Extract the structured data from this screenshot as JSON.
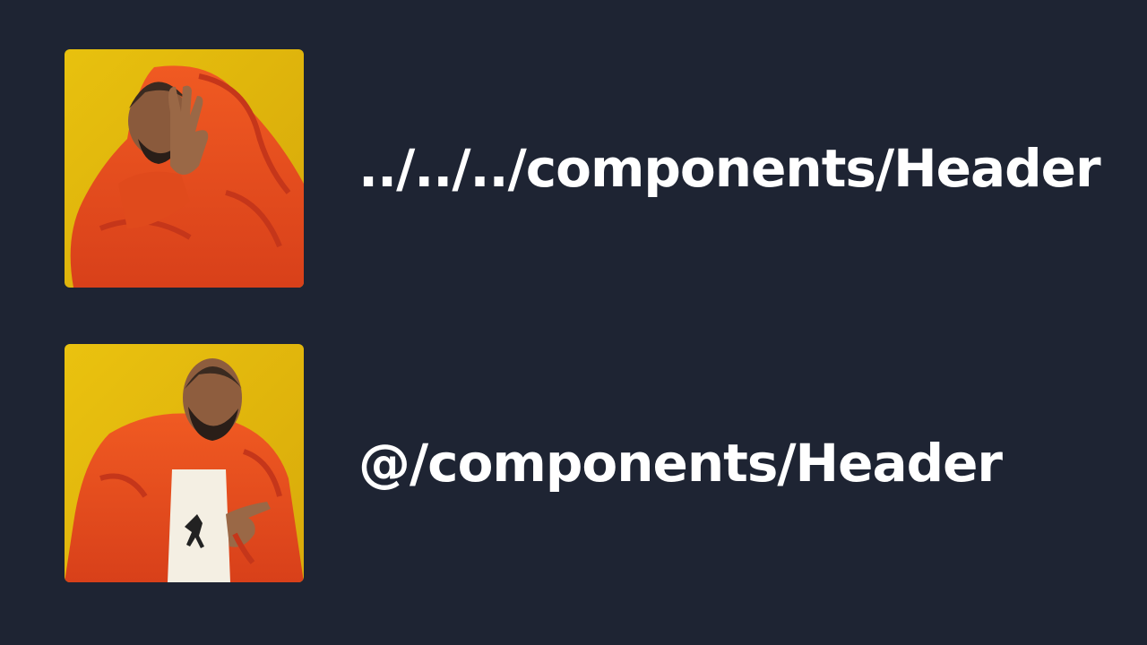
{
  "meme": {
    "panels": [
      {
        "image": "drake-rejecting",
        "caption": "../../../components/Header"
      },
      {
        "image": "drake-approving",
        "caption": "@/components/Header"
      }
    ]
  },
  "colors": {
    "background": "#1e2433",
    "text": "#ffffff",
    "panel_backdrop": "#e3bb0e",
    "jacket": "#e84a1c",
    "skin": "#8a5a3c"
  }
}
